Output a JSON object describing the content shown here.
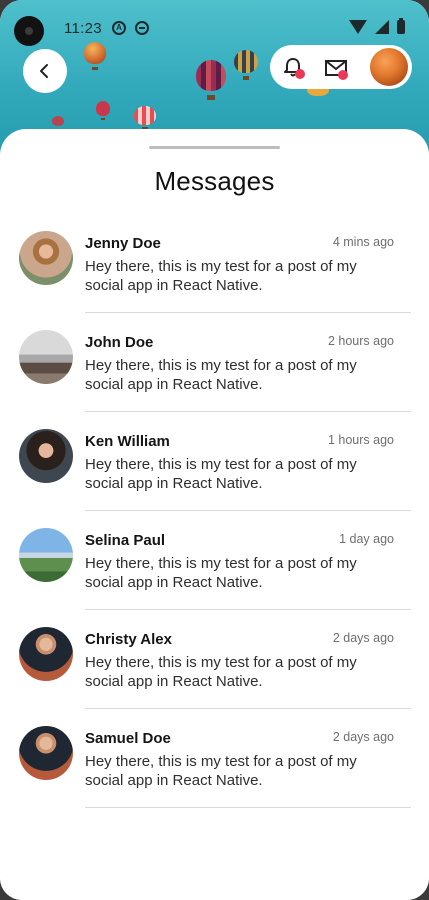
{
  "status_bar": {
    "time": "11:23",
    "icon_a": "A"
  },
  "header": {
    "back_icon": "chevron-left-icon",
    "notification_icon": "bell-icon",
    "mail_icon": "mail-icon"
  },
  "page": {
    "title": "Messages"
  },
  "colors": {
    "accent_dot": "#ec3856",
    "sky": "#33aabc"
  },
  "messages": [
    {
      "name": "Jenny Doe",
      "time": "4 mins ago",
      "body": "Hey there, this is my test for a post of my social app in React Native."
    },
    {
      "name": "John Doe",
      "time": "2 hours ago",
      "body": "Hey there, this is my test for a post of my social app in React Native."
    },
    {
      "name": "Ken William",
      "time": "1 hours ago",
      "body": "Hey there, this is my test for a post of my social app in React Native."
    },
    {
      "name": "Selina Paul",
      "time": "1 day ago",
      "body": "Hey there, this is my test for a post of my social app in React Native."
    },
    {
      "name": "Christy Alex",
      "time": "2 days ago",
      "body": "Hey there, this is my test for a post of my social app in React Native."
    },
    {
      "name": "Samuel Doe",
      "time": "2 days ago",
      "body": "Hey there, this is my test for a post of my social app in React Native."
    }
  ]
}
